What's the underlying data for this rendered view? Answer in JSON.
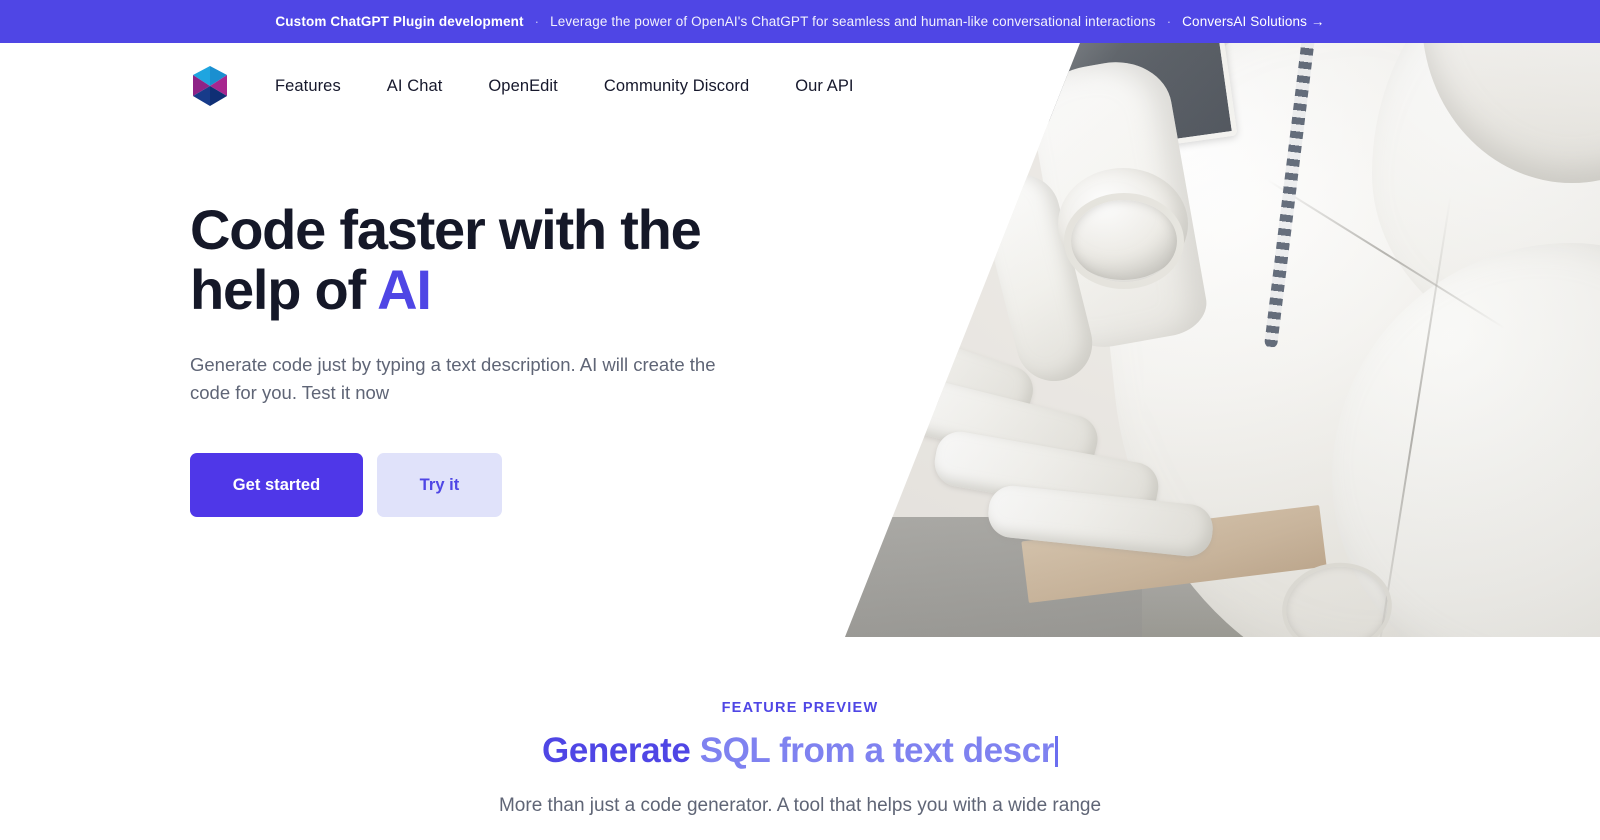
{
  "announcement": {
    "strong": "Custom ChatGPT Plugin development",
    "separator": "·",
    "text": "Leverage the power of OpenAI's ChatGPT for seamless and human-like conversational interactions",
    "link": "ConversAI Solutions →",
    "background_color": "#4f46e5"
  },
  "nav": {
    "logo_name": "hexagon-pinwheel-logo",
    "logo_colors": {
      "light_blue": "#29a9e0",
      "magenta": "#a7278f",
      "navy": "#14408c",
      "dark_navy": "#0d2f74"
    },
    "links": [
      {
        "label": "Features"
      },
      {
        "label": "AI Chat"
      },
      {
        "label": "OpenEdit"
      },
      {
        "label": "Community Discord"
      },
      {
        "label": "Our API"
      }
    ]
  },
  "hero": {
    "title_line1": "Code faster with the",
    "title_line2_prefix": "help of ",
    "title_accent": "AI",
    "subtitle": "Generate code just by typing a text description. AI will create the code for you. Test it now",
    "primary_button": "Get started",
    "secondary_button": "Try it",
    "accent_color": "#4f46e5",
    "image_alt": "white humanoid robot hand resting on a wooden block"
  },
  "feature": {
    "eyebrow": "FEATURE PREVIEW",
    "title_static": "Generate ",
    "title_typed": "SQL from a text descr",
    "description": "More than just a code generator. A tool that helps you with a wide range",
    "static_color": "#4f46e5",
    "typed_color": "#7f82f0"
  }
}
